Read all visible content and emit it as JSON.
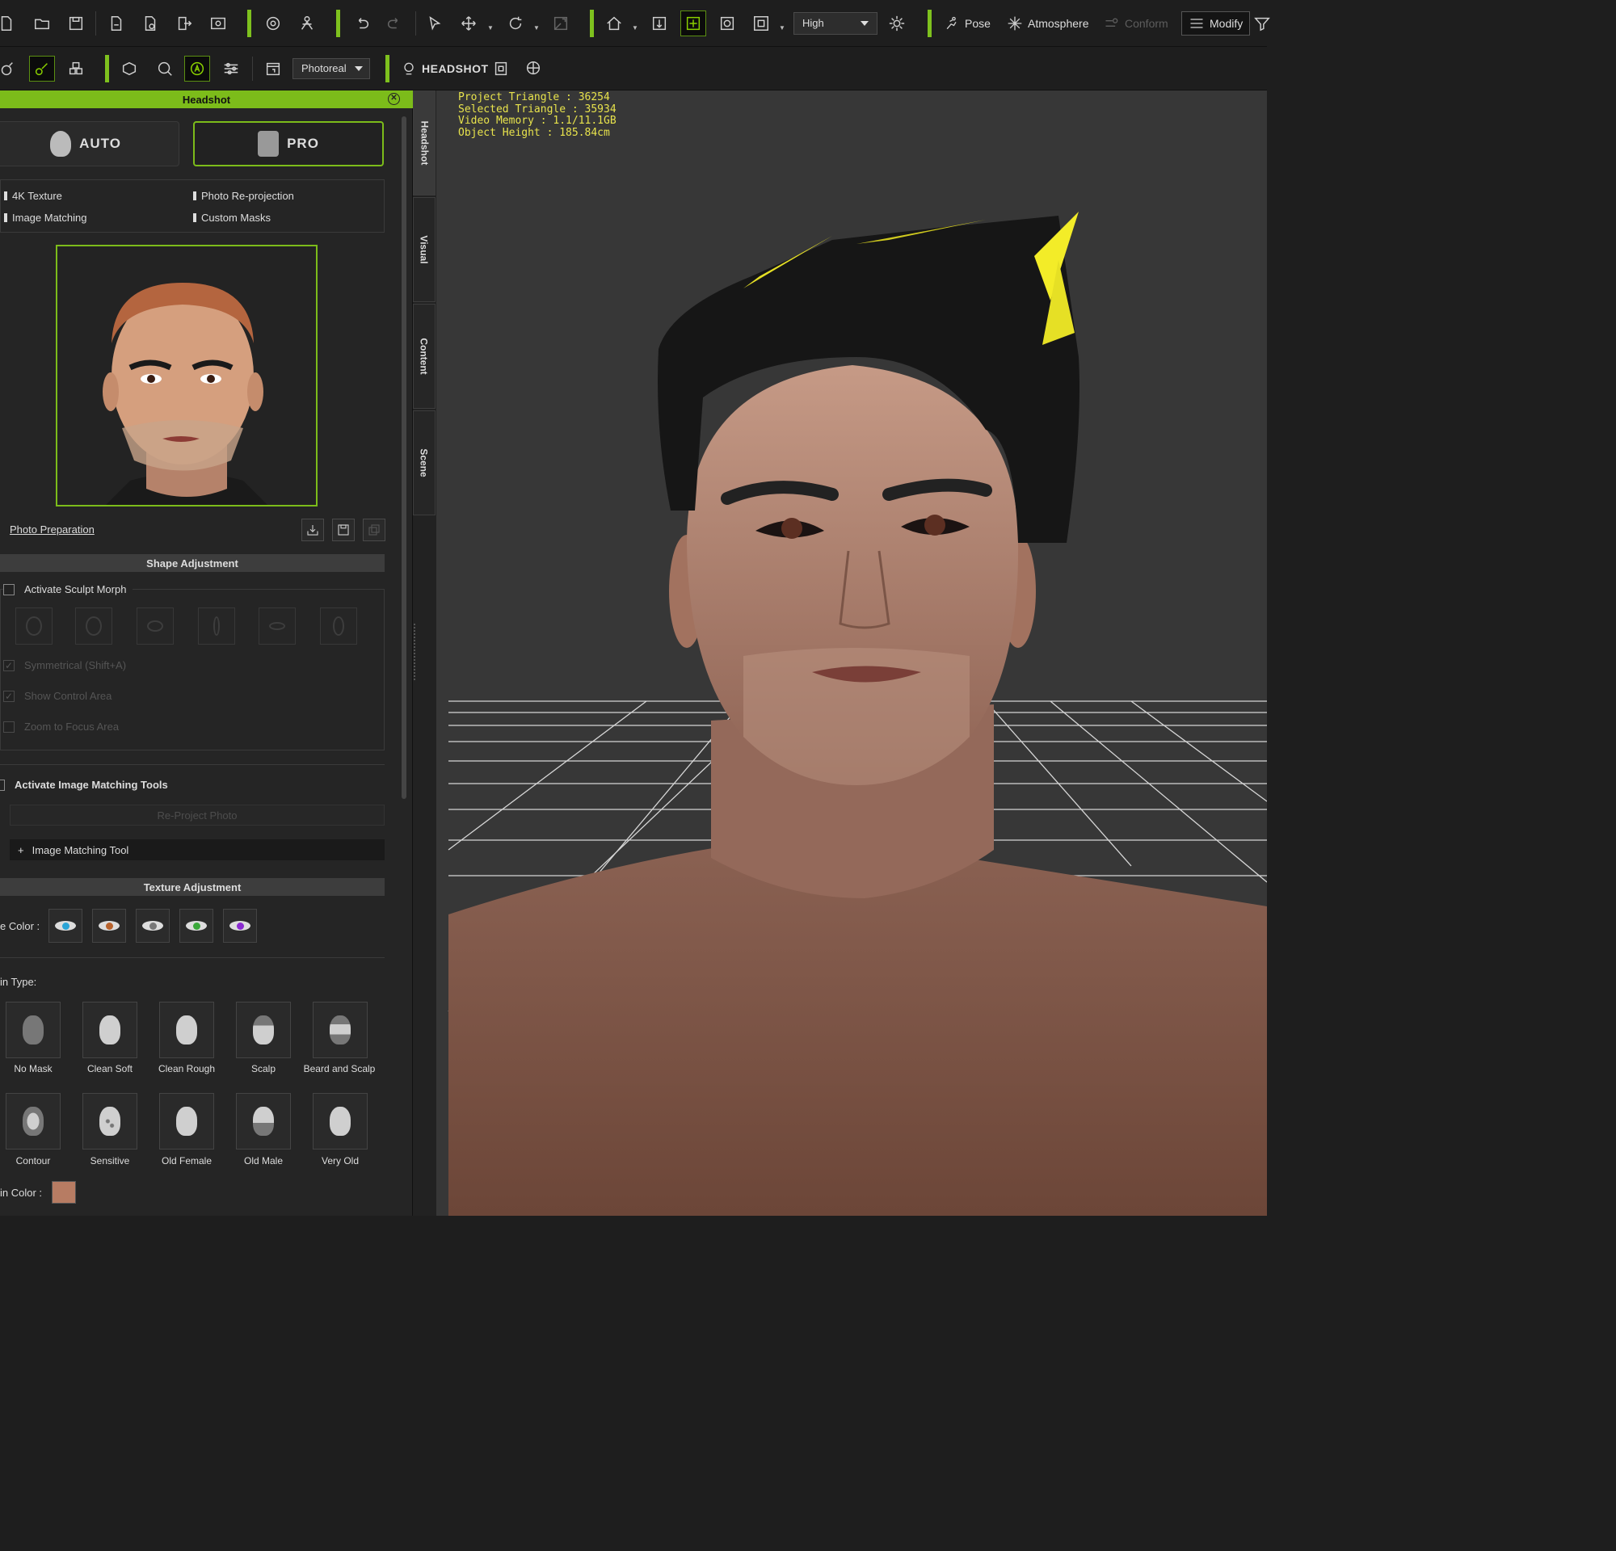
{
  "toolbar": {
    "quality_value": "High",
    "pose_label": "Pose",
    "atmosphere_label": "Atmosphere",
    "conform_label": "Conform",
    "modify_label": "Modify"
  },
  "toolbar2": {
    "render_mode": "Photoreal",
    "headshot_label": "HEADSHOT"
  },
  "panel": {
    "title": "Headshot",
    "auto_label": "AUTO",
    "pro_label": "PRO",
    "features": [
      "4K Texture",
      "Photo Re-projection",
      "Image Matching",
      "Custom Masks"
    ],
    "photo_prep": "Photo Preparation",
    "shape_header": "Shape Adjustment",
    "sculpt_morph": "Activate Sculpt Morph",
    "symmetrical": "Symmetrical (Shift+A)",
    "show_control": "Show Control Area",
    "zoom_focus": "Zoom to Focus Area",
    "image_matching_tools": "Activate Image Matching Tools",
    "reproject": "Re-Project Photo",
    "image_matching_tool": "Image Matching Tool",
    "texture_header": "Texture Adjustment",
    "eye_color_label": "e Color :",
    "eye_colors": [
      "#2aa4d6",
      "#b8622c",
      "#777777",
      "#3aa83a",
      "#8a2ad0"
    ],
    "skin_type_label": "in Type:",
    "skin_types": [
      "No Mask",
      "Clean Soft",
      "Clean Rough",
      "Scalp",
      "Beard and Scalp",
      "Contour",
      "Sensitive",
      "Old Female",
      "Old Male",
      "Very Old"
    ],
    "skin_color_label": "in Color :",
    "skin_color": "#b77c63"
  },
  "side_tabs": [
    "Headshot",
    "Visual",
    "Content",
    "Scene"
  ],
  "viewport": {
    "stats": [
      "Project Triangle : 36254",
      "Selected Triangle : 35934",
      "Video Memory : 1.1/11.1GB",
      "Object Height : 185.84cm"
    ]
  }
}
